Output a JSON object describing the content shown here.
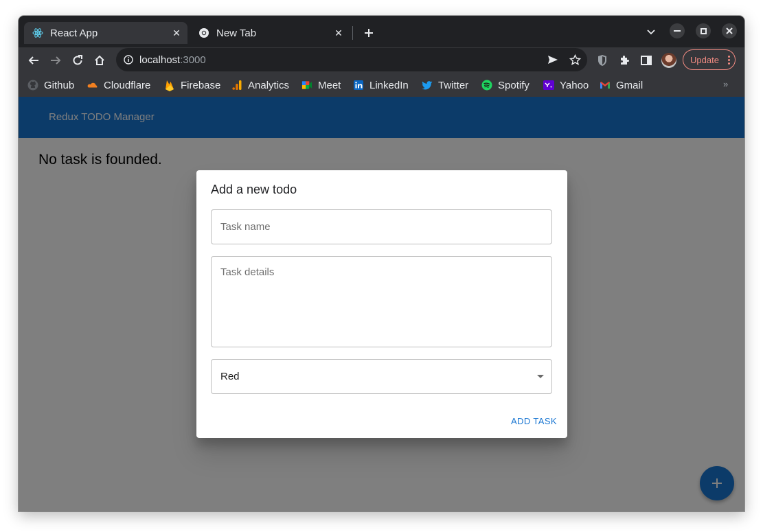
{
  "browser": {
    "tabs": [
      {
        "title": "React App",
        "icon": "react-icon",
        "active": true
      },
      {
        "title": "New Tab",
        "icon": "chrome-icon",
        "active": false
      }
    ],
    "url": {
      "host": "localhost",
      "port": ":3000"
    },
    "update_label": "Update",
    "bookmarks": [
      {
        "label": "Github",
        "icon": "github-icon"
      },
      {
        "label": "Cloudflare",
        "icon": "cloudflare-icon"
      },
      {
        "label": "Firebase",
        "icon": "firebase-icon"
      },
      {
        "label": "Analytics",
        "icon": "analytics-icon"
      },
      {
        "label": "Meet",
        "icon": "meet-icon"
      },
      {
        "label": "LinkedIn",
        "icon": "linkedin-icon"
      },
      {
        "label": "Twitter",
        "icon": "twitter-icon"
      },
      {
        "label": "Spotify",
        "icon": "spotify-icon"
      },
      {
        "label": "Yahoo",
        "icon": "yahoo-icon"
      },
      {
        "label": "Gmail",
        "icon": "gmail-icon"
      }
    ],
    "bookmarks_more": "»"
  },
  "app": {
    "title": "Redux TODO Manager",
    "empty_message": "No task is founded.",
    "fab_label": "+",
    "accent_color": "#1976d2"
  },
  "dialog": {
    "title": "Add a new todo",
    "task_name": {
      "placeholder": "Task name",
      "value": ""
    },
    "task_details": {
      "placeholder": "Task details",
      "value": ""
    },
    "color_select": {
      "value": "Red"
    },
    "submit_label": "ADD TASK"
  }
}
